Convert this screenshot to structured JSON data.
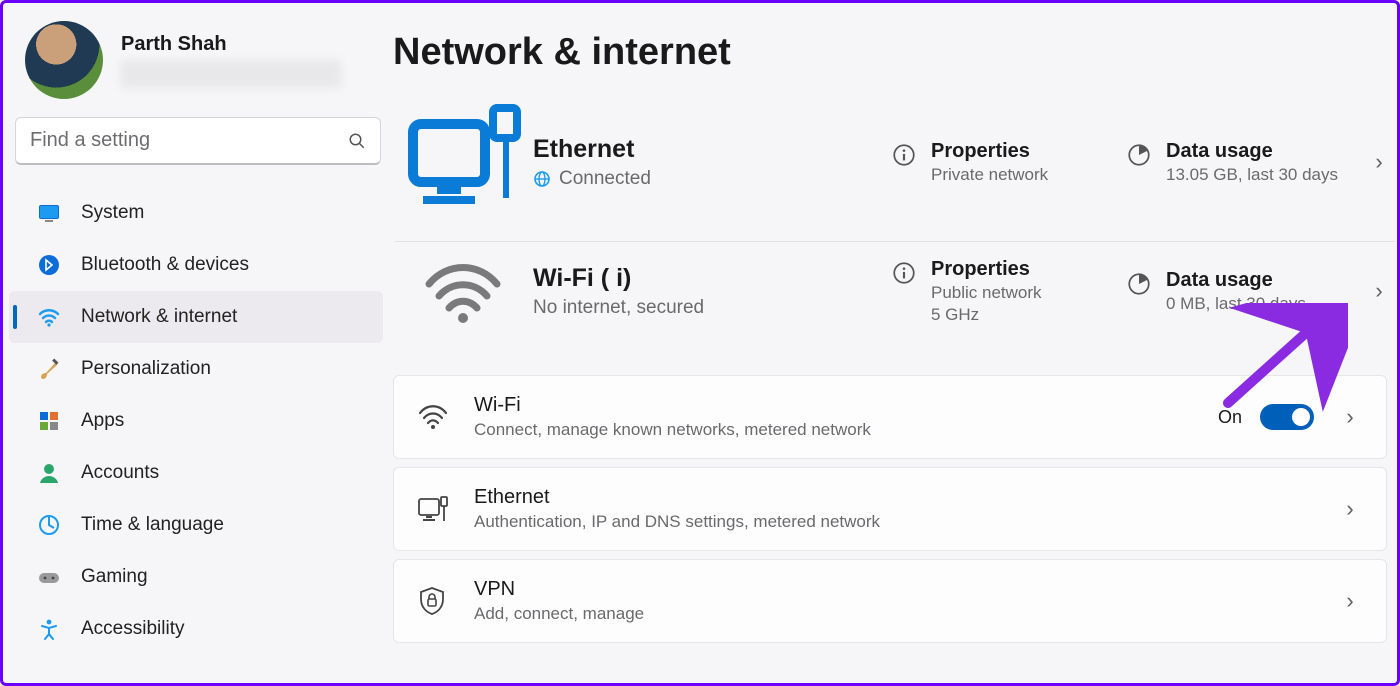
{
  "profile": {
    "name": "Parth Shah"
  },
  "search": {
    "placeholder": "Find a setting"
  },
  "nav": {
    "items": [
      {
        "label": "System"
      },
      {
        "label": "Bluetooth & devices"
      },
      {
        "label": "Network & internet"
      },
      {
        "label": "Personalization"
      },
      {
        "label": "Apps"
      },
      {
        "label": "Accounts"
      },
      {
        "label": "Time & language"
      },
      {
        "label": "Gaming"
      },
      {
        "label": "Accessibility"
      }
    ],
    "active_index": 2
  },
  "page": {
    "title": "Network & internet"
  },
  "connections": [
    {
      "name": "Ethernet",
      "status": "Connected",
      "properties": {
        "label": "Properties",
        "detail": "Private network"
      },
      "usage": {
        "label": "Data usage",
        "detail": "13.05 GB, last 30 days"
      }
    },
    {
      "name": "Wi-Fi (                      i)",
      "status": "No internet, secured",
      "properties": {
        "label": "Properties",
        "detail": "Public network",
        "detail2": "5 GHz"
      },
      "usage": {
        "label": "Data usage",
        "detail": "0 MB, last 30 days"
      }
    }
  ],
  "settings": [
    {
      "title": "Wi-Fi",
      "desc": "Connect, manage known networks, metered network",
      "toggle": true,
      "toggle_label": "On"
    },
    {
      "title": "Ethernet",
      "desc": "Authentication, IP and DNS settings, metered network"
    },
    {
      "title": "VPN",
      "desc": "Add, connect, manage"
    }
  ]
}
